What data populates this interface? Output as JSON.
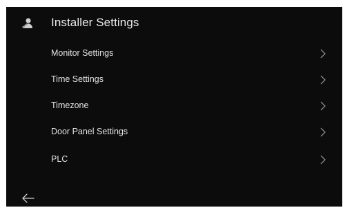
{
  "header": {
    "title": "Installer Settings",
    "icon": "installer-icon"
  },
  "menu": {
    "items": [
      {
        "label": "Monitor Settings",
        "icon": "chevron-right-icon"
      },
      {
        "label": "Time Settings",
        "icon": "chevron-right-icon"
      },
      {
        "label": "Timezone",
        "icon": "chevron-right-icon"
      },
      {
        "label": "Door Panel Settings",
        "icon": "chevron-right-icon"
      },
      {
        "label": "PLC",
        "icon": "chevron-right-icon"
      }
    ]
  },
  "footer": {
    "back_icon": "back-arrow-icon"
  },
  "colors": {
    "background": "#0c0c0c",
    "text": "#e2e2e2",
    "chevron": "#8a8a8a"
  }
}
